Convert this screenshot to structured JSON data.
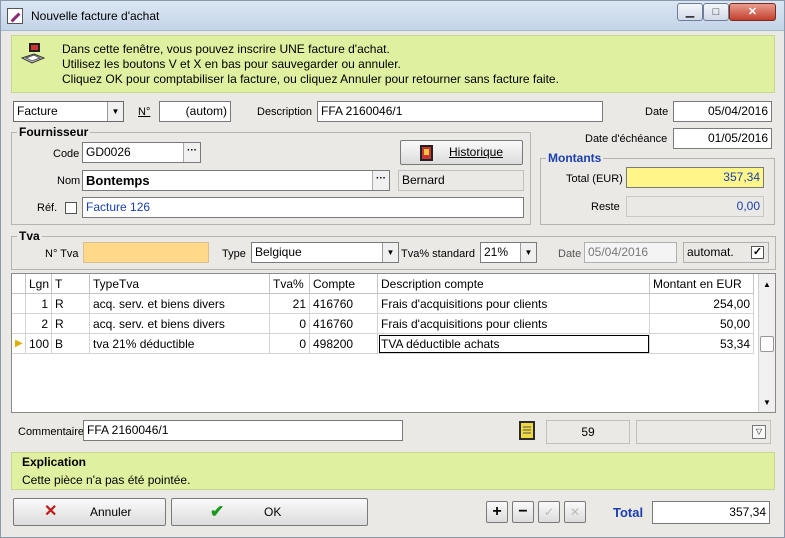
{
  "window": {
    "title": "Nouvelle facture d'achat",
    "minimize": "▁",
    "maximize": "□",
    "close": "✕"
  },
  "info": {
    "line1": "Dans cette fenêtre, vous pouvez inscrire UNE facture d'achat.",
    "line2": "Utilisez les boutons V et X en bas pour sauvegarder ou annuler.",
    "line3": "Cliquez OK pour comptabiliser la facture, ou cliquez Annuler pour retourner sans facture faite."
  },
  "header": {
    "doc_type": "Facture",
    "num_label": "N°",
    "num_value": "(autom)",
    "desc_label": "Description",
    "desc_value": "FFA 2160046/1",
    "date_label": "Date",
    "date_value": "05/04/2016",
    "due_label": "Date d'échéance",
    "due_value": "01/05/2016"
  },
  "supplier": {
    "group_title": "Fournisseur",
    "code_label": "Code",
    "code_value": "GD0026",
    "name_label": "Nom",
    "name_value": "Bontemps",
    "contact": "Bernard",
    "ref_label": "Réf.",
    "ref_value": "Facture 126",
    "history_button": "Historique",
    "ellipsis": "···"
  },
  "amounts": {
    "group_title": "Montants",
    "total_label": "Total (EUR)",
    "total_value": "357,34",
    "rest_label": "Reste",
    "rest_value": "0,00"
  },
  "vat": {
    "group_title": "Tva",
    "num_label": "N° Tva",
    "num_value": "",
    "type_label": "Type",
    "type_value": "Belgique",
    "std_label": "Tva% standard",
    "std_value": "21%",
    "date_label": "Date",
    "date_value": "05/04/2016",
    "auto_label": "automat.",
    "check": "✓"
  },
  "table": {
    "headers": [
      "Lgn",
      "T",
      "TypeTva",
      "Tva%",
      "Compte",
      "Description compte",
      "Montant en EUR"
    ],
    "rows": [
      [
        "1",
        "R",
        "acq. serv. et biens divers",
        "21",
        "416760",
        "Frais d'acquisitions pour clients",
        "254,00"
      ],
      [
        "2",
        "R",
        "acq. serv. et biens divers",
        "0",
        "416760",
        "Frais d'acquisitions pour clients",
        "50,00"
      ],
      [
        "100",
        "B",
        "tva 21% déductible",
        "0",
        "498200",
        "TVA déductible achats",
        "53,34"
      ]
    ]
  },
  "comment": {
    "label": "Commentaire",
    "value": "FFA 2160046/1",
    "count": "59"
  },
  "explanation": {
    "title": "Explication",
    "text": "Cette pièce n'a pas été pointée."
  },
  "footer": {
    "cancel": "Annuler",
    "ok": "OK",
    "plus": "+",
    "minus": "−",
    "check": "✓",
    "cross": "✕",
    "total_label": "Total",
    "total_value": "357,34"
  }
}
